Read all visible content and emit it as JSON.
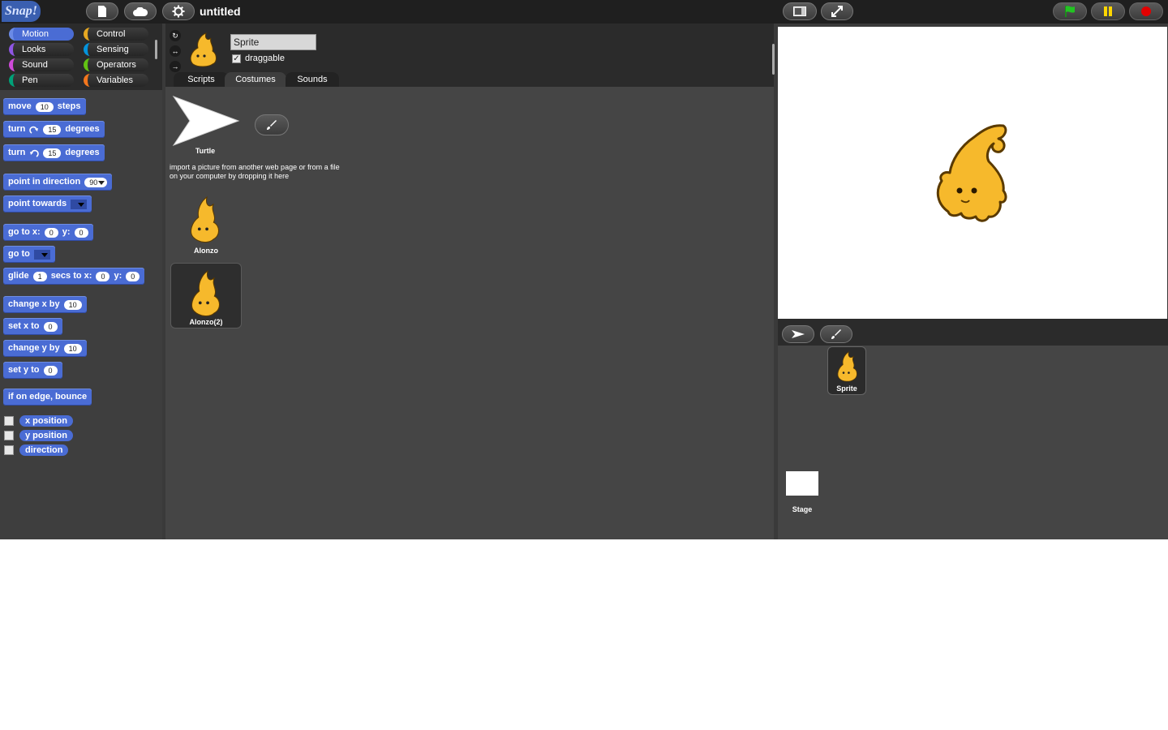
{
  "topbar": {
    "logo": "Snap!",
    "title": "untitled"
  },
  "categories": [
    {
      "label": "Motion",
      "color": "#4a6cd4"
    },
    {
      "label": "Control",
      "color": "#e6a822"
    },
    {
      "label": "Looks",
      "color": "#8f56e3"
    },
    {
      "label": "Sensing",
      "color": "#0494dc"
    },
    {
      "label": "Sound",
      "color": "#cf4ad9"
    },
    {
      "label": "Operators",
      "color": "#62c213"
    },
    {
      "label": "Pen",
      "color": "#00a178"
    },
    {
      "label": "Variables",
      "color": "#f3761d"
    }
  ],
  "blocks": {
    "move": {
      "a": "move",
      "v": "10",
      "b": "steps"
    },
    "turn_cw": {
      "a": "turn",
      "v": "15",
      "b": "degrees"
    },
    "turn_ccw": {
      "a": "turn",
      "v": "15",
      "b": "degrees"
    },
    "point_dir": {
      "a": "point in direction",
      "v": "90"
    },
    "point_towards": {
      "a": "point towards"
    },
    "goto_xy": {
      "a": "go to x:",
      "x": "0",
      "b": "y:",
      "y": "0"
    },
    "goto": {
      "a": "go to"
    },
    "glide": {
      "a": "glide",
      "v": "1",
      "b": "secs to x:",
      "x": "0",
      "c": "y:",
      "y": "0"
    },
    "change_x": {
      "a": "change x by",
      "v": "10"
    },
    "set_x": {
      "a": "set x to",
      "v": "0"
    },
    "change_y": {
      "a": "change y by",
      "v": "10"
    },
    "set_y": {
      "a": "set y to",
      "v": "0"
    },
    "bounce": {
      "a": "if on edge, bounce"
    }
  },
  "reporters": [
    "x position",
    "y position",
    "direction"
  ],
  "sprite": {
    "name": "Sprite",
    "draggable_label": "draggable",
    "draggable_checked": "✓"
  },
  "tabs": [
    "Scripts",
    "Costumes",
    "Sounds"
  ],
  "costumes": {
    "turtle_label": "Turtle",
    "hint": "import a picture from another web page or from a file on your computer by dropping it here",
    "items": [
      "Alonzo",
      "Alonzo(2)"
    ]
  },
  "corral": {
    "sprite_label": "Sprite",
    "stage_label": "Stage"
  }
}
